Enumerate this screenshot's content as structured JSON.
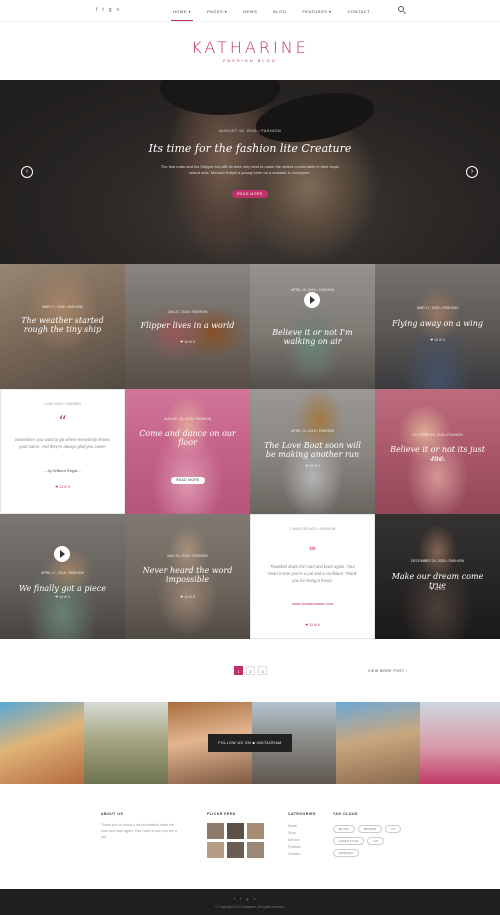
{
  "topbar": {
    "social": [
      "f",
      "t",
      "g",
      "v"
    ],
    "nav": [
      {
        "label": "HOME ▾",
        "active": true
      },
      {
        "label": "PAGES ▾",
        "active": false
      },
      {
        "label": "NEWS",
        "active": false
      },
      {
        "label": "BLOG",
        "active": false
      },
      {
        "label": "FEATURES ▾",
        "active": false
      },
      {
        "label": "CONTACT",
        "active": false
      }
    ]
  },
  "logo": {
    "name": "KATHARINE",
    "tagline": "FASHION BLOG"
  },
  "hero": {
    "meta": "AUGUST 16, 2015 • FASHION",
    "title": "Its time for the fashion lite Creature",
    "excerpt": "The first mate and his Skipper too will do their very best to make the others comfortable in their tropic island nest. Michael Knight a young loner on a crusade to champion.",
    "button": "READ MORE",
    "prev_icon": "‹",
    "next_icon": "›"
  },
  "tiles": [
    {
      "meta": "MAR 17, 2015 • FASHION",
      "title": "The weather started rough the tiny ship",
      "stats": "❤ 13  ✉ 3"
    },
    {
      "meta": "JAN 27, 2015 • FASHION",
      "title": "Flipper lives in a world",
      "stats": "❤ 14  ✉ 3"
    },
    {
      "meta": "APRIL 15, 2015 • FASHION",
      "title": "Believe it or not I'm walking on air",
      "stats": "❤ 13  ✉ 3"
    },
    {
      "meta": "MAR 17, 2015 • FASHION",
      "title": "Flying away on a wing",
      "stats": "❤ 13  ✉ 3"
    },
    {
      "meta": "1 DAY AGO • FASHION",
      "quote": "Sometimes you want to go where everybody knows your name. And they're always glad you came!",
      "by": "– by William Regal –",
      "stats": "❤ 13  ✉ 3"
    },
    {
      "meta": "AUGUST 16, 2015 • FASHION",
      "title": "Come and dance on our floor",
      "button": "READ MORE"
    },
    {
      "meta": "APRIL 14, 2015 • FASHION",
      "title": "The Love Boat soon will be making another run",
      "stats": "❤ 13  ✉ 3"
    },
    {
      "meta": "OCTOBER 15, 2015 • FASHION",
      "title": "Believe it or not its just me",
      "stats": "❤ 13  ✉ 3"
    },
    {
      "meta": "APRIL 17, 2015 • FASHION",
      "title": "We finally got a piece",
      "stats": "❤ 14  ✉ 3"
    },
    {
      "meta": "MAY 23, 2015 • FASHION",
      "title": "Never heard the word impossible",
      "stats": "❤ 14  ✉ 3"
    },
    {
      "meta": "1 MINUTES AGO • FASHION",
      "text": "Travelled down the road and back again. Your heart is true you're a pal and a confidant. Thank you for being a friend.",
      "url": "www.domainname.com",
      "stats": "❤ 13  ✉ 6"
    },
    {
      "meta": "DECEMBER 19, 2015 • FASHION",
      "title": "Make our dream come true",
      "stats": "❤ 13  ✉ 3"
    }
  ],
  "pagination": {
    "pages": [
      "1",
      "2",
      "3"
    ],
    "view_more": "VIEW MORE POST ›"
  },
  "instagram": {
    "follow": "FOLLOW US ON ◙ INSTAGRAM"
  },
  "footer": {
    "about_title": "ABOUT US",
    "about_text": "Thank you for being a friend travelled down the road and back again. Your heart is true you are a pal.",
    "flickr_title": "FLICKR FEED",
    "categories_title": "CATEGORIES",
    "categories": [
      "Music",
      "Shop",
      "Service",
      "Portfolio",
      "Contact"
    ],
    "tags_title": "TAG CLOUD",
    "tags": [
      "BLOG",
      "BRAND",
      "UI",
      "LIFESTYLE",
      "UX",
      "DESIGN"
    ]
  },
  "bottom": {
    "social": [
      "f",
      "t",
      "g",
      "v"
    ],
    "copyright": "© Copyright 2016 Katharine. All rights reserved."
  },
  "colors": {
    "accent": "#c0306a"
  }
}
